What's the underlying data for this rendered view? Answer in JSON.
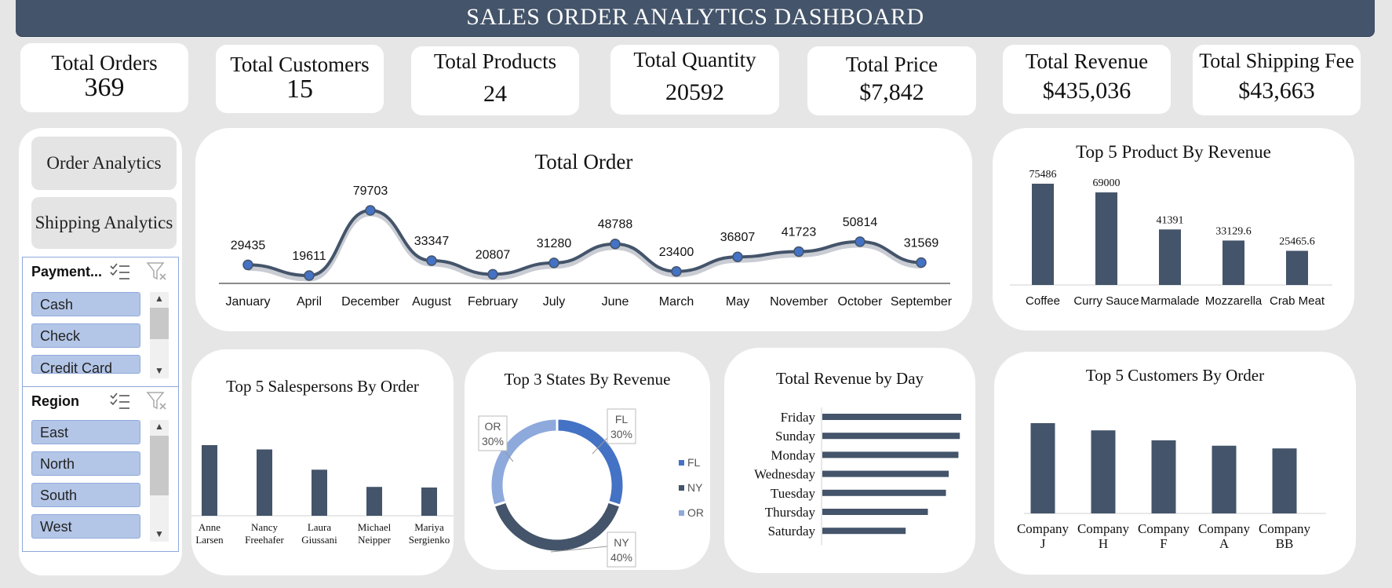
{
  "header": {
    "title": "SALES ORDER ANALYTICS DASHBOARD"
  },
  "kpis": [
    {
      "label": "Total Orders",
      "value": "369"
    },
    {
      "label": "Total Customers",
      "value": "15"
    },
    {
      "label": "Total Products",
      "value": "24"
    },
    {
      "label": "Total Quantity",
      "value": "20592"
    },
    {
      "label": "Total Price",
      "value": "$7,842"
    },
    {
      "label": "Total Revenue",
      "value": "$435,036"
    },
    {
      "label": "Total Shipping Fee",
      "value": "$43,663"
    }
  ],
  "nav": {
    "order_analytics": "Order Analytics",
    "shipping_analytics": "Shipping Analytics"
  },
  "slicers": {
    "payment": {
      "header": "Payment...",
      "items": [
        "Cash",
        "Check",
        "Credit Card"
      ]
    },
    "region": {
      "header": "Region",
      "items": [
        "East",
        "North",
        "South",
        "West"
      ]
    }
  },
  "colors": {
    "dark": "#44546a",
    "blue": "#4472c4",
    "light": "#8ea9db",
    "slicer": "#b4c6e7"
  },
  "chart_data": [
    {
      "id": "total_order",
      "type": "line",
      "title": "Total Order",
      "categories": [
        "January",
        "April",
        "December",
        "August",
        "February",
        "July",
        "June",
        "March",
        "May",
        "November",
        "October",
        "September"
      ],
      "values": [
        29435,
        19611,
        79703,
        33347,
        20807,
        31280,
        48788,
        23400,
        36807,
        41723,
        50814,
        31569
      ],
      "data_labels": true
    },
    {
      "id": "top_products",
      "type": "bar",
      "title": "Top 5 Product By Revenue",
      "categories": [
        "Coffee",
        "Curry Sauce",
        "Marmalade",
        "Mozzarella",
        "Crab Meat"
      ],
      "values": [
        75486,
        69000,
        41391,
        33129.6,
        25465.6
      ],
      "data_labels": true
    },
    {
      "id": "top_salespersons",
      "type": "bar",
      "title": "Top 5 Salespersons By Order",
      "categories": [
        "Anne Larsen",
        "Nancy Freehafer",
        "Laura Giussani",
        "Michael Neipper",
        "Mariya Sergienko"
      ],
      "values": [
        115,
        108,
        75,
        47,
        46
      ]
    },
    {
      "id": "top_states",
      "type": "pie",
      "title": "Top 3 States By Revenue",
      "categories": [
        "FL",
        "NY",
        "OR"
      ],
      "values": [
        30,
        40,
        30
      ],
      "colors": [
        "#4472c4",
        "#44546a",
        "#8ea9db"
      ],
      "legend": "right"
    },
    {
      "id": "revenue_by_day",
      "type": "bar",
      "title": "Total Revenue by Day",
      "categories": [
        "Friday",
        "Sunday",
        "Monday",
        "Wednesday",
        "Tuesday",
        "Thursday",
        "Saturday"
      ],
      "values": [
        100,
        99,
        98,
        91,
        89,
        76,
        60
      ]
    },
    {
      "id": "top_customers",
      "type": "bar",
      "title": "Top 5 Customers By Order",
      "categories": [
        "Company J",
        "Company H",
        "Company F",
        "Company A",
        "Company BB"
      ],
      "values": [
        100,
        92,
        81,
        75,
        72
      ]
    }
  ]
}
